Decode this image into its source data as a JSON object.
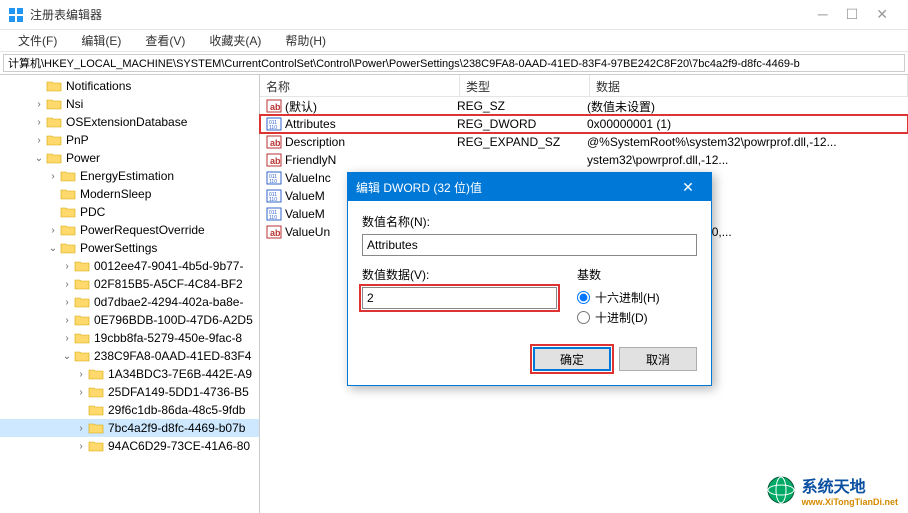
{
  "window": {
    "title": "注册表编辑器"
  },
  "menu": {
    "file": "文件(F)",
    "edit": "编辑(E)",
    "view": "查看(V)",
    "favorites": "收藏夹(A)",
    "help": "帮助(H)"
  },
  "address": "计算机\\HKEY_LOCAL_MACHINE\\SYSTEM\\CurrentControlSet\\Control\\Power\\PowerSettings\\238C9FA8-0AAD-41ED-83F4-97BE242C8F20\\7bc4a2f9-d8fc-4469-b",
  "tree": [
    {
      "indent": 2,
      "tw": "",
      "label": "Notifications"
    },
    {
      "indent": 2,
      "tw": ">",
      "label": "Nsi"
    },
    {
      "indent": 2,
      "tw": ">",
      "label": "OSExtensionDatabase"
    },
    {
      "indent": 2,
      "tw": ">",
      "label": "PnP"
    },
    {
      "indent": 2,
      "tw": "v",
      "label": "Power"
    },
    {
      "indent": 3,
      "tw": ">",
      "label": "EnergyEstimation"
    },
    {
      "indent": 3,
      "tw": "",
      "label": "ModernSleep"
    },
    {
      "indent": 3,
      "tw": "",
      "label": "PDC"
    },
    {
      "indent": 3,
      "tw": ">",
      "label": "PowerRequestOverride"
    },
    {
      "indent": 3,
      "tw": "v",
      "label": "PowerSettings"
    },
    {
      "indent": 4,
      "tw": ">",
      "label": "0012ee47-9041-4b5d-9b77-"
    },
    {
      "indent": 4,
      "tw": ">",
      "label": "02F815B5-A5CF-4C84-BF2"
    },
    {
      "indent": 4,
      "tw": ">",
      "label": "0d7dbae2-4294-402a-ba8e-"
    },
    {
      "indent": 4,
      "tw": ">",
      "label": "0E796BDB-100D-47D6-A2D5"
    },
    {
      "indent": 4,
      "tw": ">",
      "label": "19cbb8fa-5279-450e-9fac-8"
    },
    {
      "indent": 4,
      "tw": "v",
      "label": "238C9FA8-0AAD-41ED-83F4"
    },
    {
      "indent": 5,
      "tw": ">",
      "label": "1A34BDC3-7E6B-442E-A9"
    },
    {
      "indent": 5,
      "tw": ">",
      "label": "25DFA149-5DD1-4736-B5"
    },
    {
      "indent": 5,
      "tw": "",
      "label": "29f6c1db-86da-48c5-9fdb"
    },
    {
      "indent": 5,
      "tw": ">",
      "label": "7bc4a2f9-d8fc-4469-b07b",
      "selected": true
    },
    {
      "indent": 5,
      "tw": ">",
      "label": "94AC6D29-73CE-41A6-80"
    }
  ],
  "list": {
    "headers": {
      "name": "名称",
      "type": "类型",
      "data": "数据"
    },
    "rows": [
      {
        "icon": "str",
        "name": "(默认)",
        "type": "REG_SZ",
        "data": "(数值未设置)"
      },
      {
        "icon": "bin",
        "name": "Attributes",
        "type": "REG_DWORD",
        "data": "0x00000001 (1)",
        "hl": true
      },
      {
        "icon": "str",
        "name": "Description",
        "type": "REG_EXPAND_SZ",
        "data": "@%SystemRoot%\\system32\\powrprof.dll,-12..."
      },
      {
        "icon": "str",
        "name": "FriendlyN",
        "type": "",
        "data": "ystem32\\powrprof.dll,-12..."
      },
      {
        "icon": "bin",
        "name": "ValueInc",
        "type": "",
        "data": ""
      },
      {
        "icon": "bin",
        "name": "ValueM",
        "type": "",
        "data": ""
      },
      {
        "icon": "bin",
        "name": "ValueM",
        "type": "",
        "data": ""
      },
      {
        "icon": "str",
        "name": "ValueUn",
        "type": "",
        "data": "ystem32\\powrprof.dll,-80,..."
      }
    ]
  },
  "dialog": {
    "title": "编辑 DWORD (32 位)值",
    "name_label": "数值名称(N):",
    "name_value": "Attributes",
    "data_label": "数值数据(V):",
    "data_value": "2",
    "base_label": "基数",
    "hex_label": "十六进制(H)",
    "dec_label": "十进制(D)",
    "ok": "确定",
    "cancel": "取消"
  },
  "watermark": {
    "brand": "系统天地",
    "url": "www.XiTongTianDi.net"
  }
}
